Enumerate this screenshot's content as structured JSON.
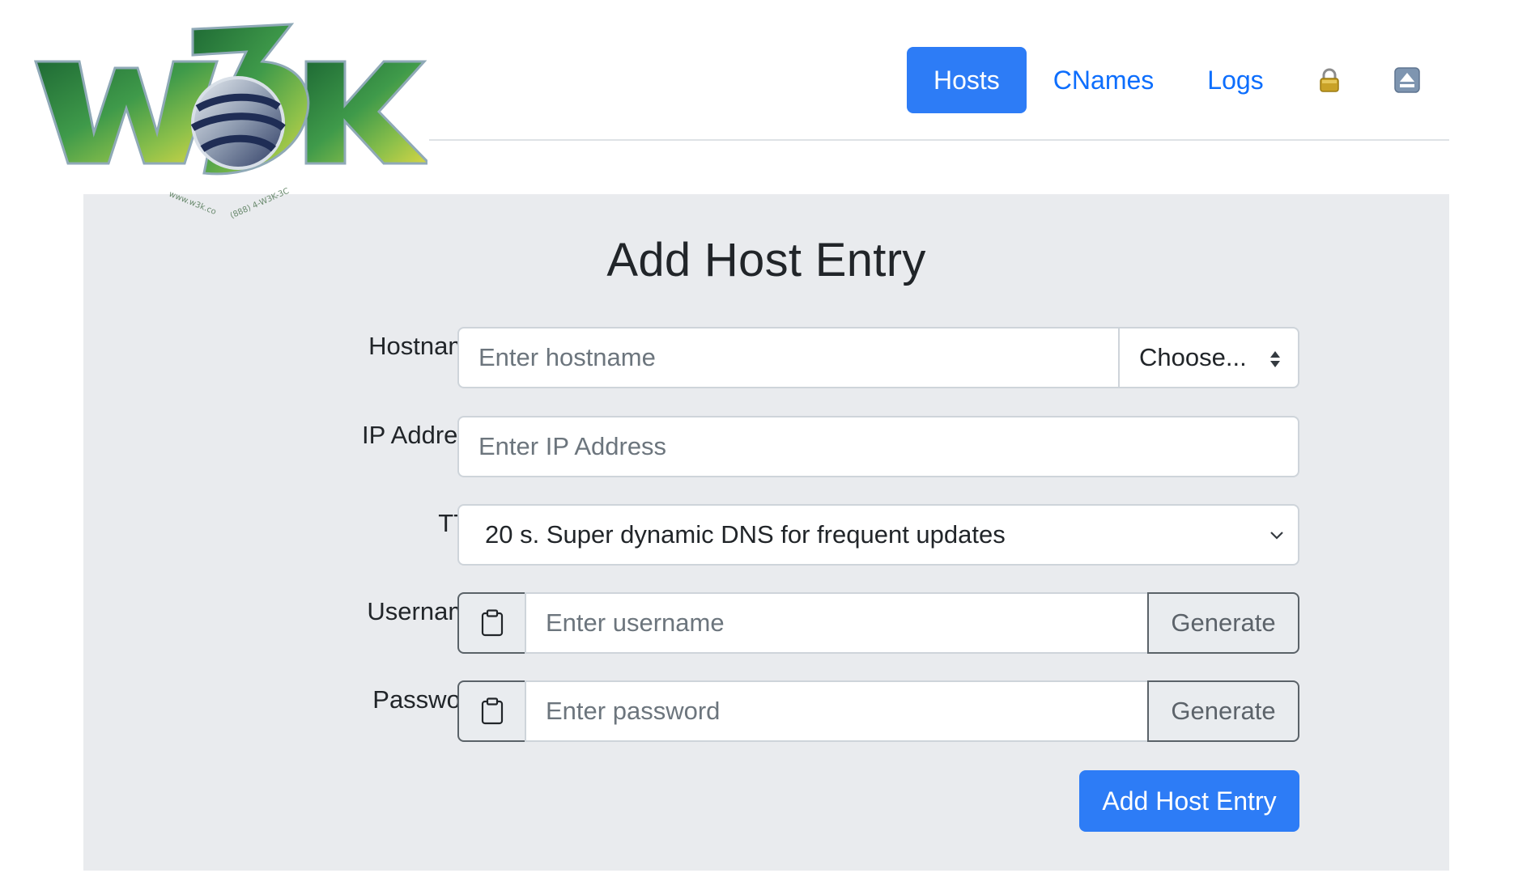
{
  "nav": {
    "hosts": "Hosts",
    "cnames": "CNames",
    "logs": "Logs",
    "lock_icon": "lock-icon",
    "eject_icon": "eject-icon"
  },
  "logo": {
    "text": "W3K",
    "tagline_left": "www.w3k.co",
    "tagline_right": "(888) 4-W3K-3C"
  },
  "form": {
    "title": "Add Host Entry",
    "hostname": {
      "label": "Hostname:",
      "placeholder": "Enter hostname",
      "select_value": "Choose..."
    },
    "ip": {
      "label": "IP Address:",
      "placeholder": "Enter IP Address"
    },
    "ttl": {
      "label": "TTL:",
      "value": "20 s. Super dynamic DNS for frequent updates"
    },
    "username": {
      "label": "Username:",
      "placeholder": "Enter username",
      "generate": "Generate",
      "copy_icon": "clipboard-icon"
    },
    "password": {
      "label": "Password:",
      "placeholder": "Enter password",
      "generate": "Generate",
      "copy_icon": "clipboard-icon"
    },
    "submit": "Add Host Entry"
  },
  "colors": {
    "primary": "#2d7cf6",
    "link": "#0d6efd",
    "panel_bg": "#e9ebee"
  }
}
